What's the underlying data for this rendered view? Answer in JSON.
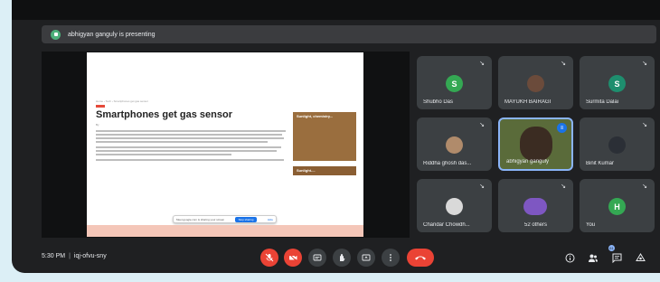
{
  "banner": {
    "text": "abhigyan ganguly is presenting"
  },
  "slide": {
    "crumb": "Home › Tech › Smartphones get gas sensor",
    "headline": "Smartphones get gas sensor",
    "byline_prefix": "By",
    "side_card_caption": "Sunlight, chemistry...",
    "side_card2_caption": "Sunlight-...",
    "share_msg": "Meet.google.com is sharing your screen",
    "share_stop": "Stop sharing",
    "share_hide": "Hide"
  },
  "participants": [
    {
      "name": "Shubho Das",
      "initial": "S",
      "color": "#34a853",
      "type": "initial"
    },
    {
      "name": "MAYUKH BAIRAGI",
      "initial": "",
      "color": "#6b4b3b",
      "type": "photo"
    },
    {
      "name": "Surmita Dalai",
      "initial": "S",
      "color": "#1e8e6e",
      "type": "initial"
    },
    {
      "name": "Riddha ghosh das...",
      "initial": "",
      "color": "#b08b6b",
      "type": "photo"
    },
    {
      "name": "abhigyan ganguly",
      "initial": "",
      "color": "#5a6b3a",
      "type": "video"
    },
    {
      "name": "Binit Kumar",
      "initial": "",
      "color": "#2b2f36",
      "type": "photo"
    },
    {
      "name": "Chandar Chowdh...",
      "initial": "",
      "color": "#d9d9d9",
      "type": "photo"
    },
    {
      "name": "52 others",
      "initial": "",
      "color": "#7e57c2",
      "type": "group"
    },
    {
      "name": "You",
      "initial": "H",
      "color": "#34a853",
      "type": "initial"
    }
  ],
  "controls": {
    "time": "5:30 PM",
    "separator": "|",
    "meeting_code": "iqj-ofvu-sny",
    "participants_badge": "61",
    "icons": {
      "mic": "mic-off-icon",
      "camera": "camera-off-icon",
      "captions": "captions-icon",
      "raise_hand": "raise-hand-icon",
      "present": "present-icon",
      "more": "more-options-icon",
      "hangup": "hang-up-icon",
      "info": "info-icon",
      "people": "people-icon",
      "chat": "chat-icon",
      "activities": "activities-icon"
    }
  },
  "colors": {
    "background": "#1f2022",
    "tile": "#3c4043",
    "accent_red": "#ea4335",
    "accent_blue": "#8ab4f8"
  }
}
